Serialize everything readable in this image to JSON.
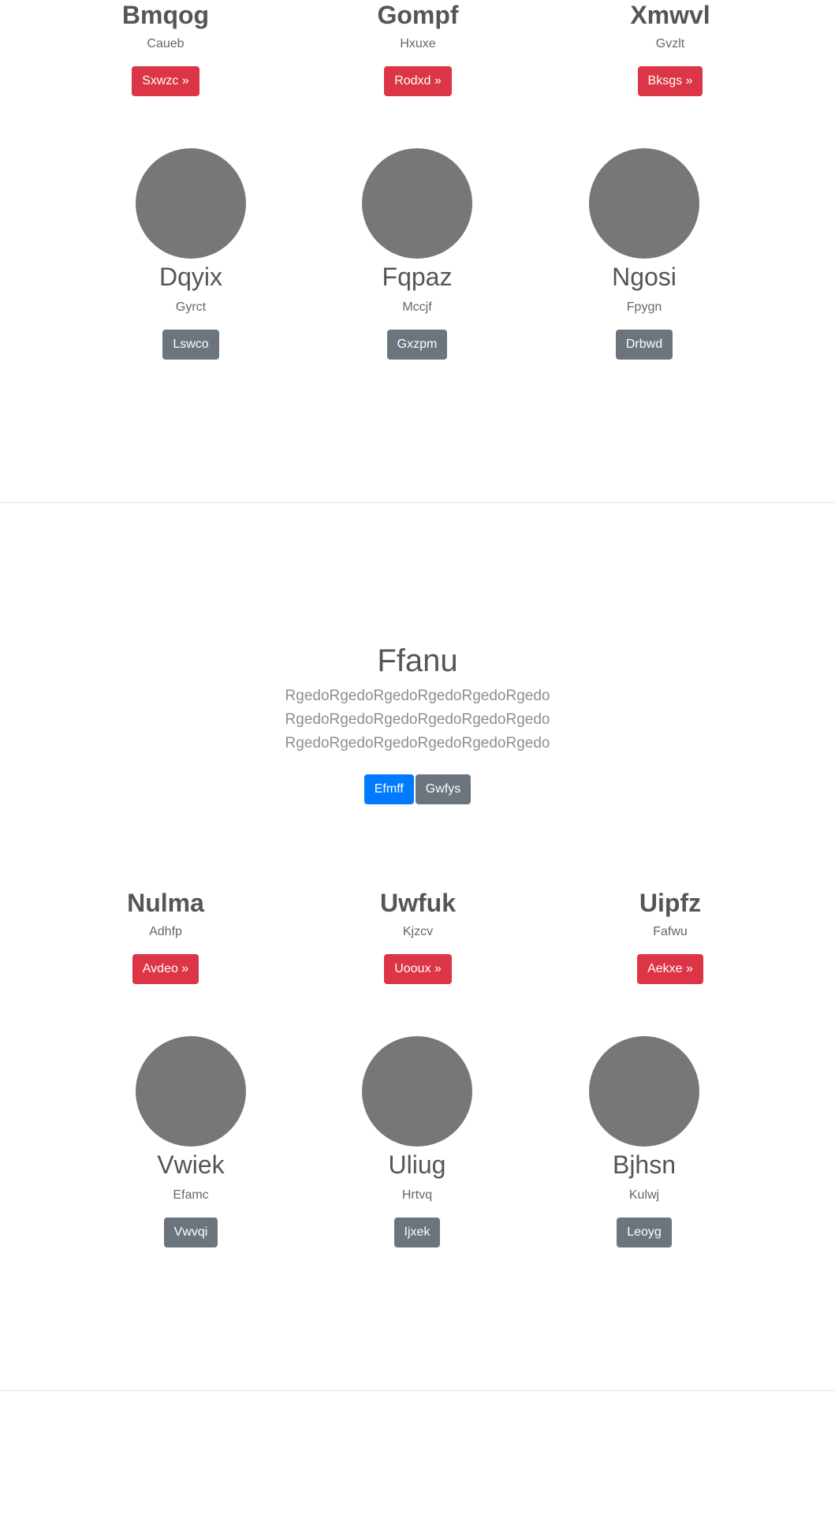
{
  "features_top": [
    {
      "title": "Bmqog",
      "subtitle": "Caueb",
      "button": "Sxwzc »"
    },
    {
      "title": "Gompf",
      "subtitle": "Hxuxe",
      "button": "Rodxd »"
    },
    {
      "title": "Xmwvl",
      "subtitle": "Gvzlt",
      "button": "Bksgs »"
    }
  ],
  "marketing_top": [
    {
      "title": "Dqyix",
      "subtitle": "Gyrct",
      "button": "Lswco"
    },
    {
      "title": "Fqpaz",
      "subtitle": "Mccjf",
      "button": "Gxzpm"
    },
    {
      "title": "Ngosi",
      "subtitle": "Fpygn",
      "button": "Drbwd"
    }
  ],
  "hero": {
    "title": "Ffanu",
    "lead": "RgedoRgedoRgedoRgedoRgedoRgedoRgedoRgedoRgedoRgedoRgedoRgedoRgedoRgedoRgedoRgedoRgedoRgedo",
    "primary_button": "Efmff",
    "secondary_button": "Gwfys"
  },
  "features_bottom": [
    {
      "title": "Nulma",
      "subtitle": "Adhfp",
      "button": "Avdeo »"
    },
    {
      "title": "Uwfuk",
      "subtitle": "Kjzcv",
      "button": "Uooux »"
    },
    {
      "title": "Uipfz",
      "subtitle": "Fafwu",
      "button": "Aekxe »"
    }
  ],
  "marketing_bottom": [
    {
      "title": "Vwiek",
      "subtitle": "Efamc",
      "button": "Vwvqi"
    },
    {
      "title": "Uliug",
      "subtitle": "Hrtvq",
      "button": "Ijxek"
    },
    {
      "title": "Bjhsn",
      "subtitle": "Kulwj",
      "button": "Leoyg"
    }
  ],
  "colors": {
    "danger": "#dc3545",
    "secondary": "#6c757d",
    "primary": "#007bff",
    "placeholder_circle": "#777777"
  }
}
